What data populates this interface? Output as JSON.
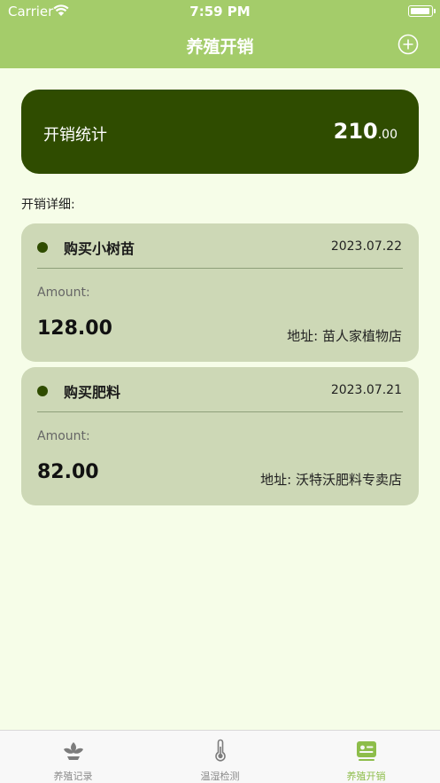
{
  "status_bar": {
    "carrier": "Carrier",
    "time": "7:59 PM"
  },
  "nav": {
    "title": "养殖开销"
  },
  "summary": {
    "label": "开销统计",
    "total_int": "210",
    "total_dec": ".00"
  },
  "section_title": "开销详细:",
  "expenses": [
    {
      "name": "购买小树苗",
      "date": "2023.07.22",
      "amount_label": "Amount:",
      "amount": "128.00",
      "address": "地址: 苗人家植物店"
    },
    {
      "name": "购买肥料",
      "date": "2023.07.21",
      "amount_label": "Amount:",
      "amount": "82.00",
      "address": "地址: 沃特沃肥料专卖店"
    }
  ],
  "tabs": [
    {
      "label": "养殖记录",
      "icon": "plant-icon"
    },
    {
      "label": "温湿检测",
      "icon": "thermometer-icon"
    },
    {
      "label": "养殖开销",
      "icon": "expense-card-icon",
      "active": true
    }
  ],
  "colors": {
    "nav": "#a4cc6a",
    "summary_bg": "#2f4c00",
    "card_bg": "#cdd8b6",
    "page_bg": "#f6fde8",
    "active_tab": "#8dbd4a"
  }
}
